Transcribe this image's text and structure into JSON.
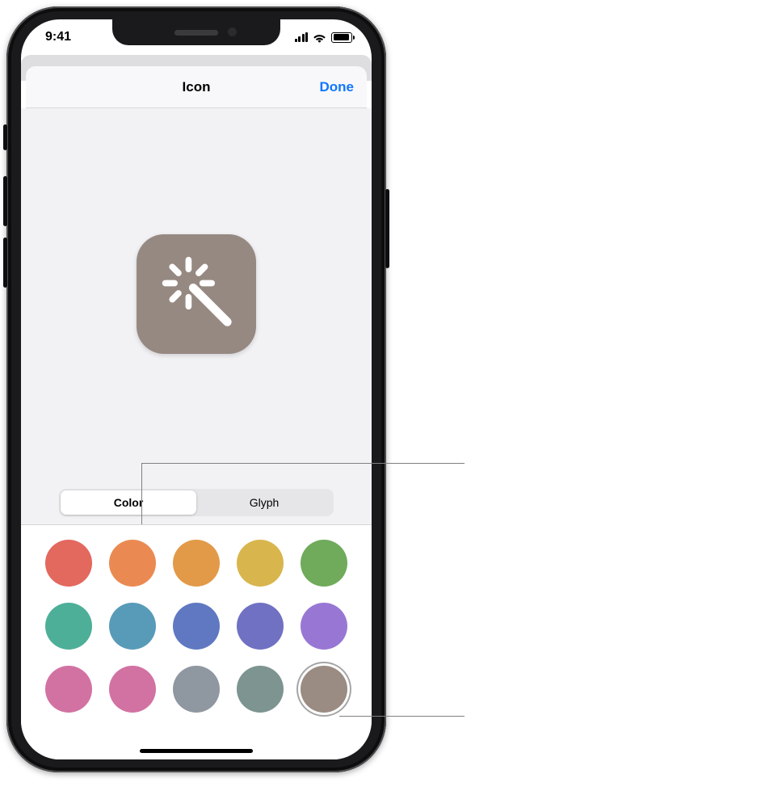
{
  "status": {
    "time": "9:41"
  },
  "nav": {
    "title": "Icon",
    "done": "Done"
  },
  "preview": {
    "color": "#968982",
    "glyph": "wand"
  },
  "segments": {
    "items": [
      {
        "id": "color",
        "label": "Color",
        "selected": true
      },
      {
        "id": "glyph",
        "label": "Glyph",
        "selected": false
      }
    ]
  },
  "palette": {
    "selectedIndex": 14,
    "colors": [
      "#e3685e",
      "#ea8a52",
      "#e29a48",
      "#d9b54e",
      "#6fab5b",
      "#4eaf99",
      "#589bb8",
      "#5f78c1",
      "#7071c2",
      "#9877d4",
      "#d272a2",
      "#d272a2",
      "#8f97a1",
      "#7d9490",
      "#9a8c83"
    ]
  }
}
